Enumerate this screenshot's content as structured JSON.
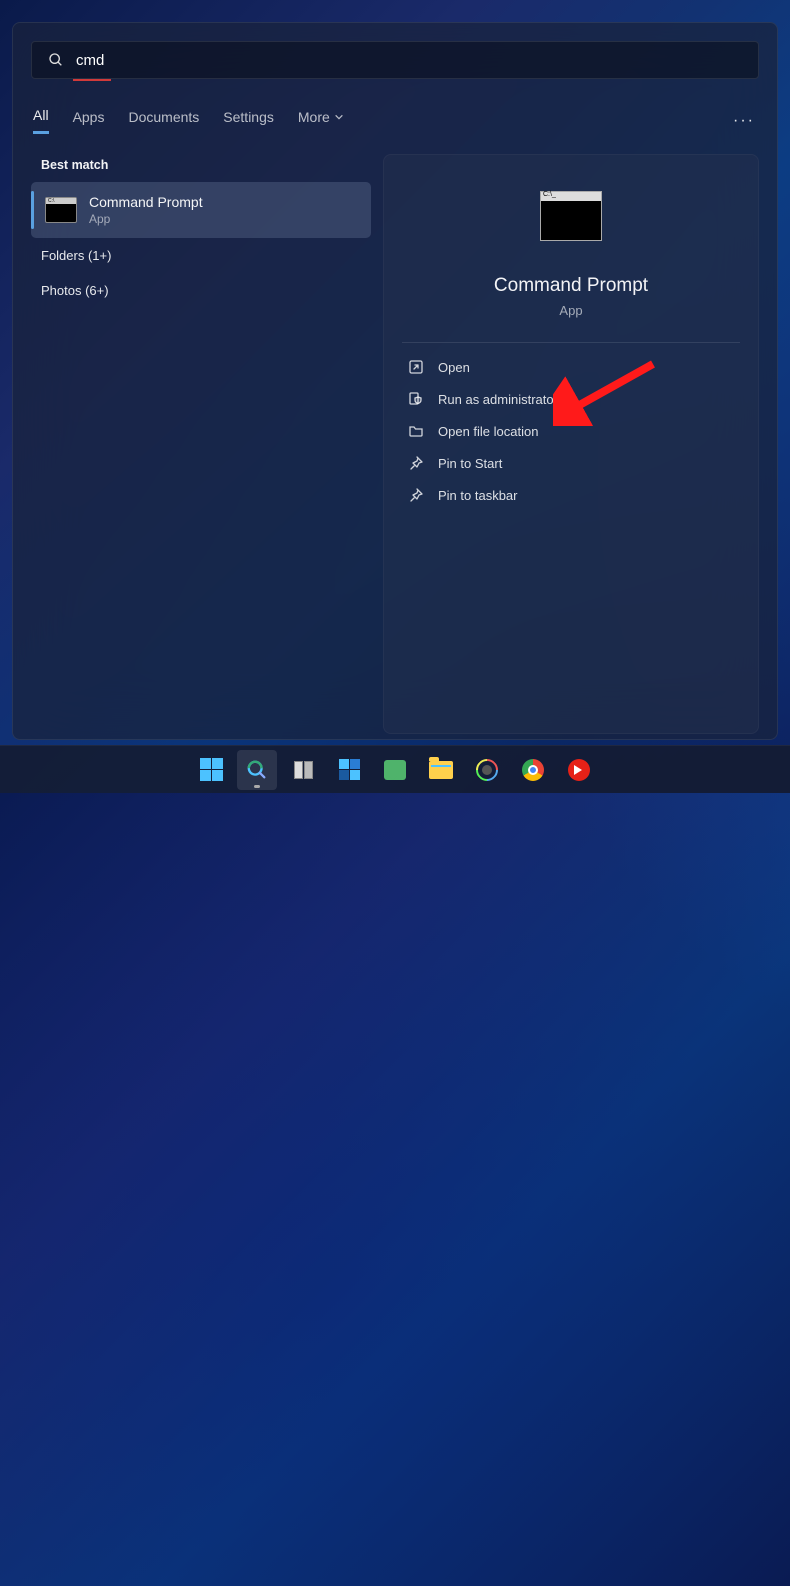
{
  "search": {
    "value": "cmd"
  },
  "tabs": {
    "all": "All",
    "apps": "Apps",
    "documents": "Documents",
    "settings": "Settings",
    "more": "More"
  },
  "sections": {
    "best_match": "Best match"
  },
  "best_match_result": {
    "title": "Command Prompt",
    "subtitle": "App"
  },
  "other_results": {
    "folders": "Folders (1+)",
    "photos": "Photos (6+)"
  },
  "preview": {
    "title": "Command Prompt",
    "subtitle": "App"
  },
  "actions": {
    "open": "Open",
    "run_admin": "Run as administrator",
    "open_location": "Open file location",
    "pin_start": "Pin to Start",
    "pin_taskbar": "Pin to taskbar"
  }
}
